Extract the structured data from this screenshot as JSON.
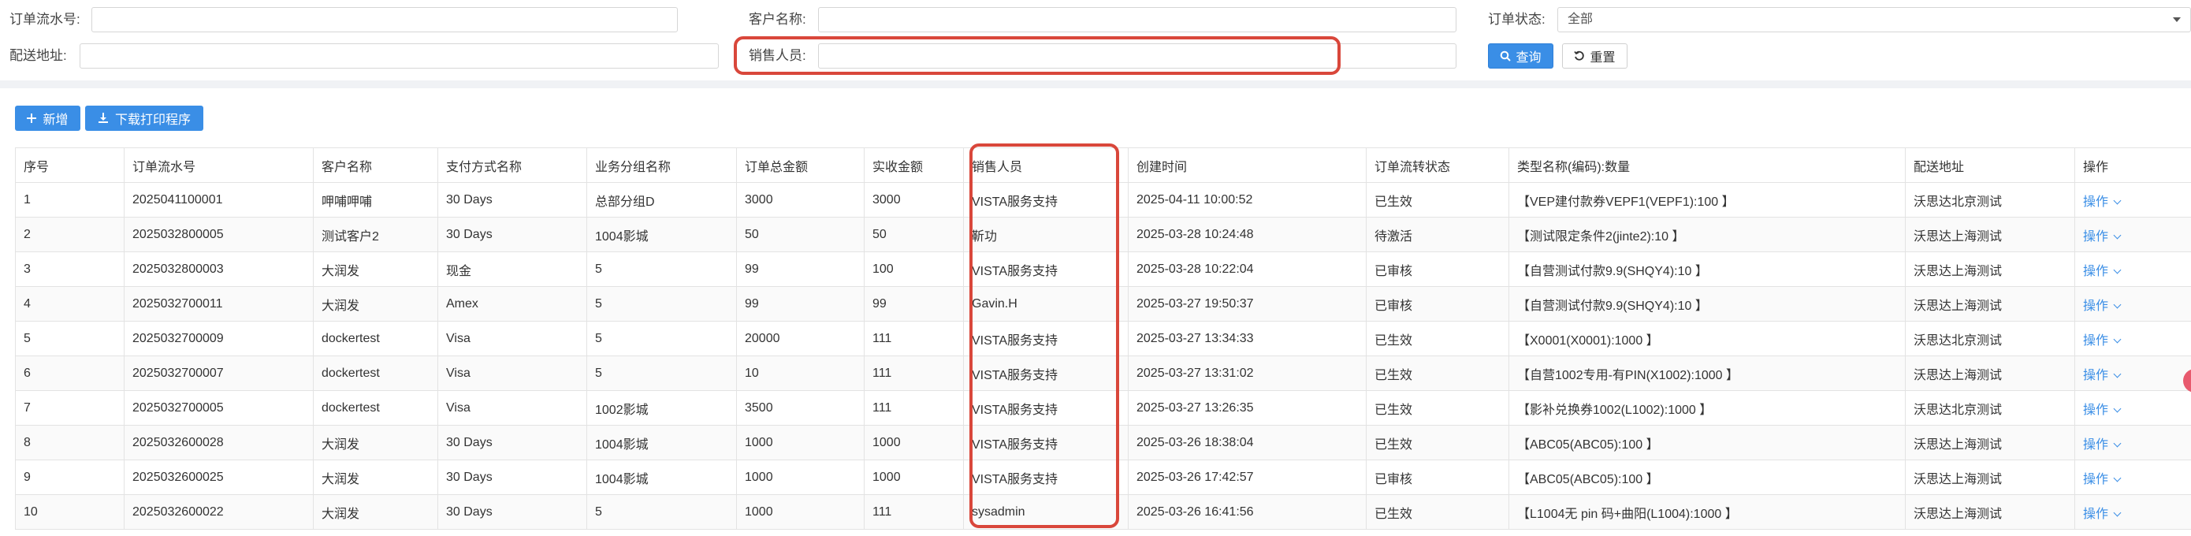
{
  "filters": {
    "order_no_label": "订单流水号:",
    "customer_label": "客户名称:",
    "status_label": "订单状态:",
    "status_value": "全部",
    "address_label": "配送地址:",
    "sales_label": "销售人员:",
    "query_label": "查询",
    "reset_label": "重置"
  },
  "toolbar": {
    "add_label": "新增",
    "download_label": "下载打印程序"
  },
  "table": {
    "headers": [
      "序号",
      "订单流水号",
      "客户名称",
      "支付方式名称",
      "业务分组名称",
      "订单总金额",
      "实收金额",
      "销售人员",
      "创建时间",
      "订单流转状态",
      "类型名称(编码):数量",
      "配送地址",
      "操作"
    ],
    "rows": [
      [
        "1",
        "2025041100001",
        "呷哺呷哺",
        "30 Days",
        "总部分组D",
        "3000",
        "3000",
        "VISTA服务支持",
        "2025-04-11 10:00:52",
        "已生效",
        "【VEP建付款券VEPF1(VEPF1):100 】",
        "沃思达北京测试",
        "操作"
      ],
      [
        "2",
        "2025032800005",
        "测试客户2",
        "30 Days",
        "1004影城",
        "50",
        "50",
        "靳功",
        "2025-03-28 10:24:48",
        "待激活",
        "【测试限定条件2(jinte2):10 】",
        "沃思达上海测试",
        "操作"
      ],
      [
        "3",
        "2025032800003",
        "大润发",
        "现金",
        "5",
        "99",
        "100",
        "VISTA服务支持",
        "2025-03-28 10:22:04",
        "已审核",
        "【自营测试付款9.9(SHQY4):10 】",
        "沃思达上海测试",
        "操作"
      ],
      [
        "4",
        "2025032700011",
        "大润发",
        "Amex",
        "5",
        "99",
        "99",
        "Gavin.H",
        "2025-03-27 19:50:37",
        "已审核",
        "【自营测试付款9.9(SHQY4):10 】",
        "沃思达上海测试",
        "操作"
      ],
      [
        "5",
        "2025032700009",
        "dockertest",
        "Visa",
        "5",
        "20000",
        "111",
        "VISTA服务支持",
        "2025-03-27 13:34:33",
        "已生效",
        "【X0001(X0001):1000 】",
        "沃思达北京测试",
        "操作"
      ],
      [
        "6",
        "2025032700007",
        "dockertest",
        "Visa",
        "5",
        "10",
        "111",
        "VISTA服务支持",
        "2025-03-27 13:31:02",
        "已生效",
        "【自营1002专用-有PIN(X1002):1000 】",
        "沃思达上海测试",
        "操作"
      ],
      [
        "7",
        "2025032700005",
        "dockertest",
        "Visa",
        "1002影城",
        "3500",
        "111",
        "VISTA服务支持",
        "2025-03-27 13:26:35",
        "已生效",
        "【影补兑换券1002(L1002):1000 】",
        "沃思达北京测试",
        "操作"
      ],
      [
        "8",
        "2025032600028",
        "大润发",
        "30 Days",
        "1004影城",
        "1000",
        "1000",
        "VISTA服务支持",
        "2025-03-26 18:38:04",
        "已生效",
        "【ABC05(ABC05):100 】",
        "沃思达上海测试",
        "操作"
      ],
      [
        "9",
        "2025032600025",
        "大润发",
        "30 Days",
        "1004影城",
        "1000",
        "1000",
        "VISTA服务支持",
        "2025-03-26 17:42:57",
        "已审核",
        "【ABC05(ABC05):100 】",
        "沃思达上海测试",
        "操作"
      ],
      [
        "10",
        "2025032600022",
        "大润发",
        "30 Days",
        "5",
        "1000",
        "111",
        "sysadmin",
        "2025-03-26 16:41:56",
        "已生效",
        "【L1004无 pin 码+曲阳(L1004):1000 】",
        "沃思达上海测试",
        "操作"
      ]
    ]
  },
  "colors": {
    "primary": "#3a8ee6",
    "highlight": "#d9473b"
  }
}
